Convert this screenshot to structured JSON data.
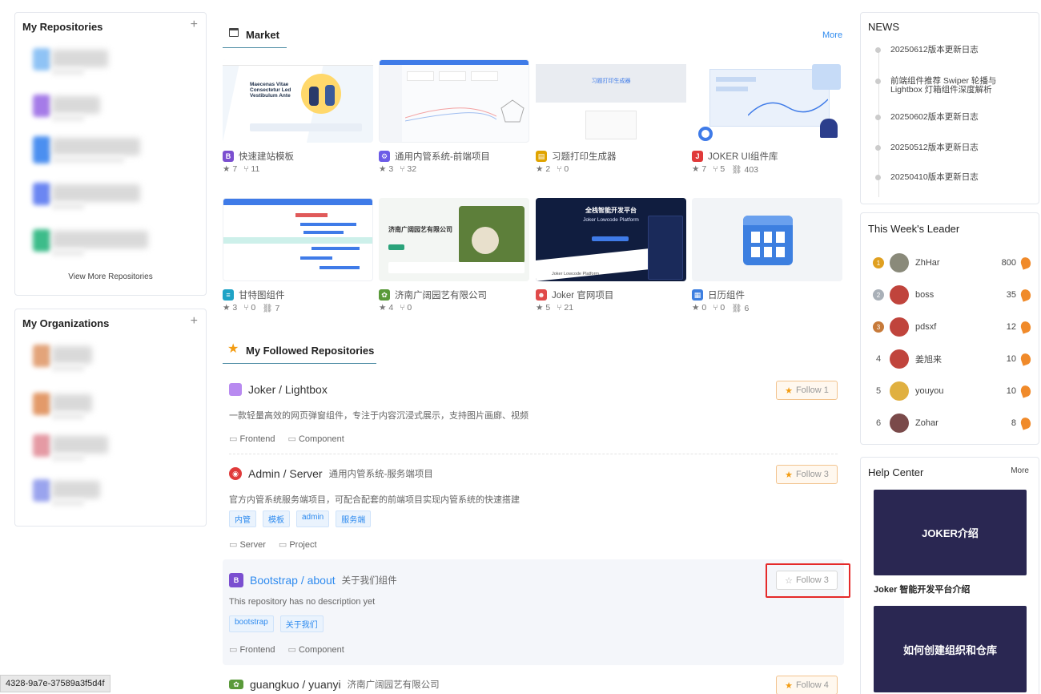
{
  "left": {
    "repos_title": "My Repositories",
    "plus": "+",
    "view_more": "View More Repositories",
    "orgs_title": "My Organizations"
  },
  "market": {
    "title": "Market",
    "more": "More",
    "cards": [
      {
        "name": "快速建站模板",
        "stars": "7",
        "forks": "11",
        "links": "",
        "icon_color": "#7b4fd0",
        "icon_text": "B"
      },
      {
        "name": "通用内管系统-前端项目",
        "stars": "3",
        "forks": "32",
        "links": "",
        "icon_color": "#6c5ce7",
        "icon_text": "⚙"
      },
      {
        "name": "习题打印生成器",
        "stars": "2",
        "forks": "0",
        "links": "",
        "icon_color": "#e0a400",
        "icon_text": "▤"
      },
      {
        "name": "JOKER UI组件库",
        "stars": "7",
        "forks": "5",
        "links": "403",
        "icon_color": "#e03a3a",
        "icon_text": "J"
      },
      {
        "name": "甘特图组件",
        "stars": "3",
        "forks": "0",
        "links": "7",
        "icon_color": "#1fa3c6",
        "icon_text": "≡"
      },
      {
        "name": "济南广阔园艺有限公司",
        "stars": "4",
        "forks": "0",
        "links": "",
        "icon_color": "#5a9a3a",
        "icon_text": "✿"
      },
      {
        "name": "Joker 官网项目",
        "stars": "5",
        "forks": "21",
        "links": "",
        "icon_color": "#e04a4a",
        "icon_text": "☻"
      },
      {
        "name": "日历组件",
        "stars": "0",
        "forks": "0",
        "links": "6",
        "icon_color": "#3d7fe0",
        "icon_text": "▦"
      }
    ],
    "thumbs": {
      "t1_heading": "Maecenas Vitae Consectetur Led Vestibulum Ante",
      "t3_heading": "习题打印生成器",
      "t6_heading": "济南广阔园艺有限公司",
      "t7_heading": "全栈智能开发平台",
      "t7_sub": "Joker Lowcode Platform",
      "t7_foot": "Joker Lowcode Platform"
    }
  },
  "followed": {
    "title": "My Followed Repositories",
    "repos": [
      {
        "title": "Joker / Lightbox",
        "sub": "",
        "desc": "一款轻量高效的网页弹窗组件，专注于内容沉浸式展示，支持图片画廊、视频",
        "tags": [],
        "meta": [
          "Frontend",
          "Component"
        ],
        "follow": "Follow 1"
      },
      {
        "title": "Admin / Server",
        "sub": "通用内管系统-服务端项目",
        "desc": "官方内管系统服务端项目，可配合配套的前端项目实现内管系统的快速搭建",
        "tags": [
          "内管",
          "模板",
          "admin",
          "服务端"
        ],
        "meta": [
          "Server",
          "Project"
        ],
        "follow": "Follow 3"
      },
      {
        "title": "Bootstrap / about",
        "sub": "关于我们组件",
        "desc": "This repository has no description yet",
        "tags": [
          "bootstrap",
          "关于我们"
        ],
        "meta": [
          "Frontend",
          "Component"
        ],
        "follow": "Follow 3"
      },
      {
        "title": "guangkuo / yuanyi",
        "sub": "济南广阔园艺有限公司",
        "desc": "",
        "tags": [],
        "meta": [],
        "follow": "Follow 4"
      }
    ]
  },
  "news": {
    "title": "NEWS",
    "items": [
      "20250612版本更新日志",
      "前端组件推荐 Swiper 轮播与 Lightbox 灯箱组件深度解析",
      "20250602版本更新日志",
      "20250512版本更新日志",
      "20250410版本更新日志"
    ]
  },
  "leader": {
    "title": "This Week's Leader",
    "rows": [
      {
        "rank": "",
        "medal": "gold",
        "name": "ZhHar",
        "score": "800"
      },
      {
        "rank": "",
        "medal": "silver",
        "name": "boss",
        "score": "35"
      },
      {
        "rank": "",
        "medal": "bronze",
        "name": "pdsxf",
        "score": "12"
      },
      {
        "rank": "4",
        "medal": "",
        "name": "姜旭来",
        "score": "10"
      },
      {
        "rank": "5",
        "medal": "",
        "name": "youyou",
        "score": "10"
      },
      {
        "rank": "6",
        "medal": "",
        "name": "Zohar",
        "score": "8"
      }
    ]
  },
  "help": {
    "title": "Help Center",
    "more": "More",
    "items": [
      {
        "image_text": "JOKER介绍",
        "caption": "Joker 智能开发平台介绍"
      },
      {
        "image_text": "如何创建组织和仓库",
        "caption": ""
      }
    ]
  },
  "statusbar": {
    "text": "4328-9a7e-37589a3f5d4f"
  }
}
